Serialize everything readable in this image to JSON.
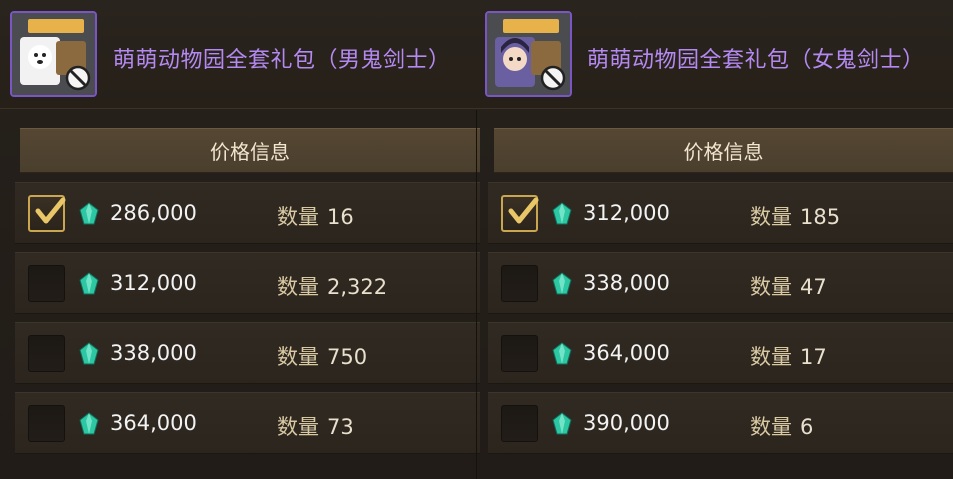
{
  "panels": [
    {
      "title": "萌萌动物园全套礼包（男鬼剑士）",
      "icon": "item-package-icon-male-slayer",
      "price_header": "价格信息",
      "quantity_label": "数量",
      "rows": [
        {
          "checked": true,
          "price": "286,000",
          "quantity": "16"
        },
        {
          "checked": false,
          "price": "312,000",
          "quantity": "2,322"
        },
        {
          "checked": false,
          "price": "338,000",
          "quantity": "750"
        },
        {
          "checked": false,
          "price": "364,000",
          "quantity": "73"
        }
      ]
    },
    {
      "title": "萌萌动物园全套礼包（女鬼剑士）",
      "icon": "item-package-icon-female-slayer",
      "price_header": "价格信息",
      "quantity_label": "数量",
      "rows": [
        {
          "checked": true,
          "price": "312,000",
          "quantity": "185"
        },
        {
          "checked": false,
          "price": "338,000",
          "quantity": "47"
        },
        {
          "checked": false,
          "price": "364,000",
          "quantity": "17"
        },
        {
          "checked": false,
          "price": "390,000",
          "quantity": "6"
        }
      ]
    }
  ],
  "colors": {
    "title": "#b589f2",
    "icon_border": "#7a56c4",
    "checkbox_checked_border": "#c9a64f",
    "gem": "#33d6b0"
  }
}
